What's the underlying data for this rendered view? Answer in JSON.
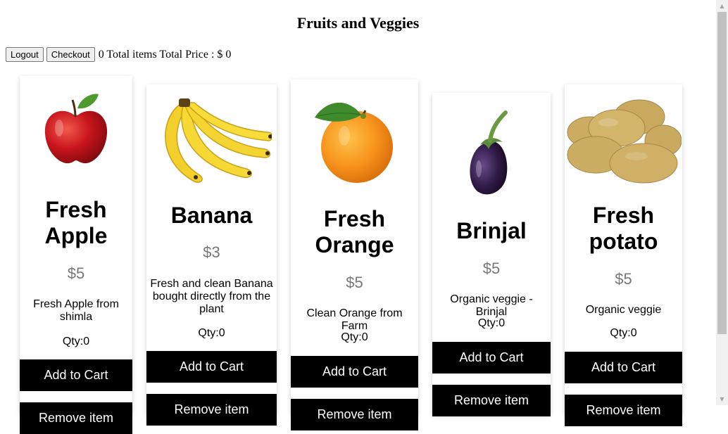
{
  "page": {
    "title": "Fruits and Veggies"
  },
  "toolbar": {
    "logout_label": "Logout",
    "checkout_label": "Checkout",
    "summary": "0 Total items Total Price : $ 0"
  },
  "products": [
    {
      "name": "Fresh Apple",
      "price": "$5",
      "description": "Fresh Apple from shimla",
      "qty": "Qty:0",
      "add_label": "Add to Cart",
      "remove_label": "Remove item",
      "image_icon": "apple-image"
    },
    {
      "name": "Banana",
      "price": "$3",
      "description": "Fresh and clean Banana bought directly from the plant",
      "qty": "Qty:0",
      "add_label": "Add to Cart",
      "remove_label": "Remove item",
      "image_icon": "banana-image"
    },
    {
      "name": "Fresh Orange",
      "price": "$5",
      "description": "Clean Orange from Farm",
      "qty": "Qty:0",
      "add_label": "Add to Cart",
      "remove_label": "Remove item",
      "image_icon": "orange-image"
    },
    {
      "name": "Brinjal",
      "price": "$5",
      "description": "Organic veggie - Brinjal",
      "qty": "Qty:0",
      "add_label": "Add to Cart",
      "remove_label": "Remove item",
      "image_icon": "brinjal-image"
    },
    {
      "name": "Fresh potato",
      "price": "$5",
      "description": "Organic veggie",
      "qty": "Qty:0",
      "add_label": "Add to Cart",
      "remove_label": "Remove item",
      "image_icon": "potato-image"
    }
  ],
  "colors": {
    "button_bg": "#000000",
    "button_text": "#ffffff",
    "price": "#777777"
  }
}
